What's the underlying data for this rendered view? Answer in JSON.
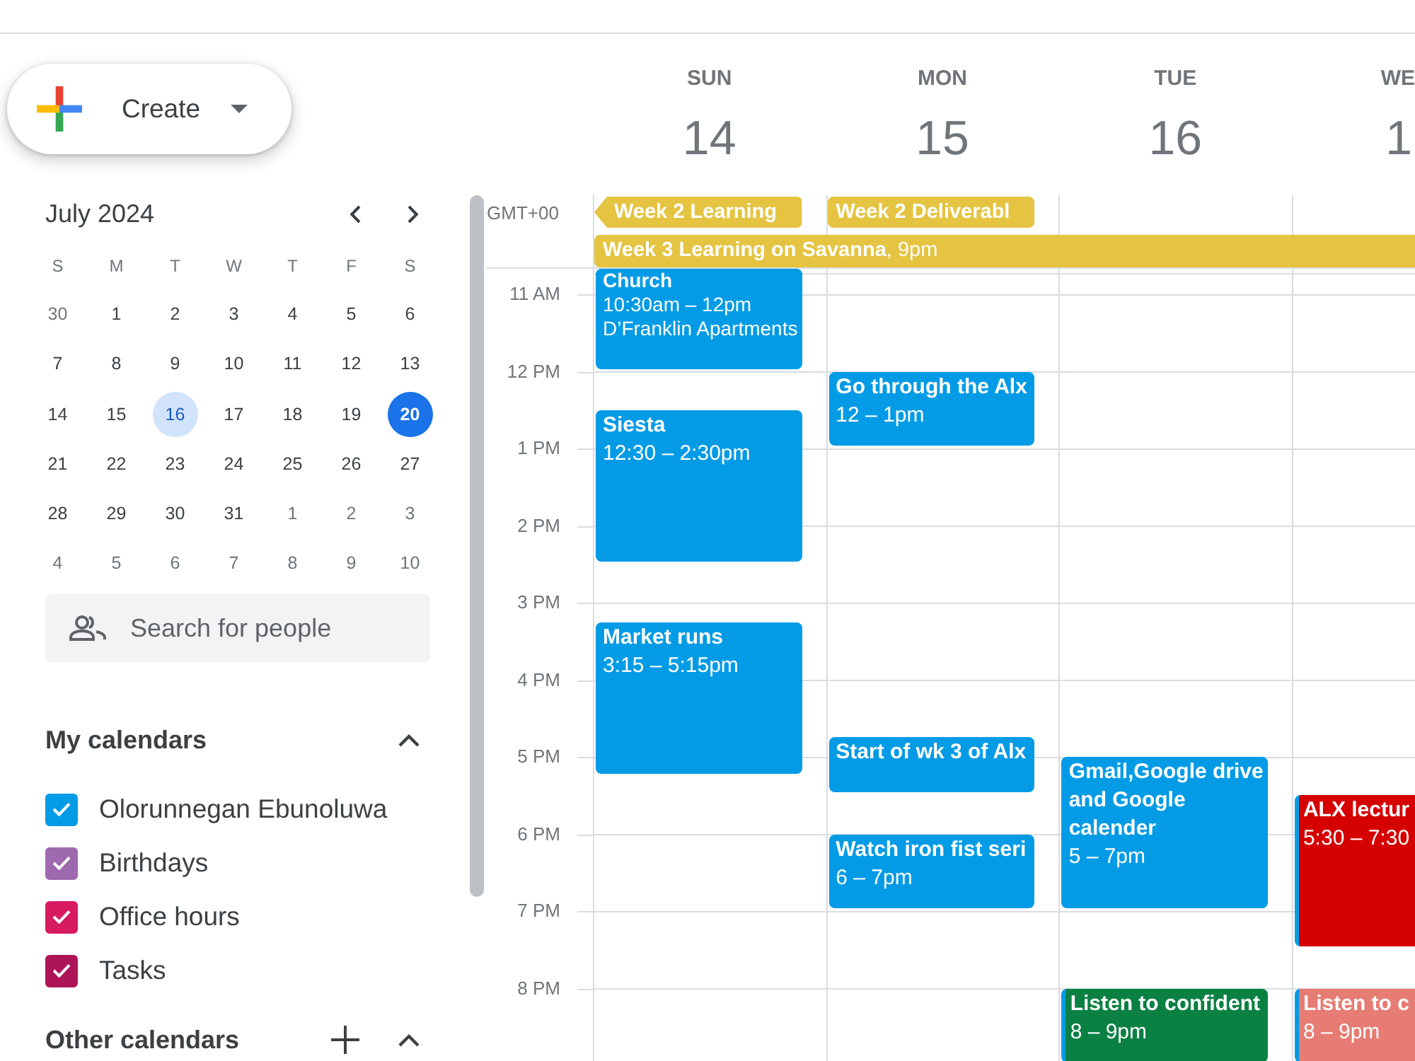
{
  "sidebar": {
    "create_button": {
      "label": "Create"
    },
    "mini_calendar": {
      "title": "July 2024",
      "weekdays": [
        "S",
        "M",
        "T",
        "W",
        "T",
        "F",
        "S"
      ],
      "weeks": [
        [
          {
            "label": "30",
            "outside": true,
            "selected": false,
            "today": false
          },
          {
            "label": "1",
            "outside": false,
            "selected": false,
            "today": false
          },
          {
            "label": "2",
            "outside": false,
            "selected": false,
            "today": false
          },
          {
            "label": "3",
            "outside": false,
            "selected": false,
            "today": false
          },
          {
            "label": "4",
            "outside": false,
            "selected": false,
            "today": false
          },
          {
            "label": "5",
            "outside": false,
            "selected": false,
            "today": false
          },
          {
            "label": "6",
            "outside": false,
            "selected": false,
            "today": false
          }
        ],
        [
          {
            "label": "7",
            "outside": false,
            "selected": false,
            "today": false
          },
          {
            "label": "8",
            "outside": false,
            "selected": false,
            "today": false
          },
          {
            "label": "9",
            "outside": false,
            "selected": false,
            "today": false
          },
          {
            "label": "10",
            "outside": false,
            "selected": false,
            "today": false
          },
          {
            "label": "11",
            "outside": false,
            "selected": false,
            "today": false
          },
          {
            "label": "12",
            "outside": false,
            "selected": false,
            "today": false
          },
          {
            "label": "13",
            "outside": false,
            "selected": false,
            "today": false
          }
        ],
        [
          {
            "label": "14",
            "outside": false,
            "selected": false,
            "today": false
          },
          {
            "label": "15",
            "outside": false,
            "selected": false,
            "today": false
          },
          {
            "label": "16",
            "outside": false,
            "selected": true,
            "today": false
          },
          {
            "label": "17",
            "outside": false,
            "selected": false,
            "today": false
          },
          {
            "label": "18",
            "outside": false,
            "selected": false,
            "today": false
          },
          {
            "label": "19",
            "outside": false,
            "selected": false,
            "today": false
          },
          {
            "label": "20",
            "outside": false,
            "selected": false,
            "today": true
          }
        ],
        [
          {
            "label": "21",
            "outside": false,
            "selected": false,
            "today": false
          },
          {
            "label": "22",
            "outside": false,
            "selected": false,
            "today": false
          },
          {
            "label": "23",
            "outside": false,
            "selected": false,
            "today": false
          },
          {
            "label": "24",
            "outside": false,
            "selected": false,
            "today": false
          },
          {
            "label": "25",
            "outside": false,
            "selected": false,
            "today": false
          },
          {
            "label": "26",
            "outside": false,
            "selected": false,
            "today": false
          },
          {
            "label": "27",
            "outside": false,
            "selected": false,
            "today": false
          }
        ],
        [
          {
            "label": "28",
            "outside": false,
            "selected": false,
            "today": false
          },
          {
            "label": "29",
            "outside": false,
            "selected": false,
            "today": false
          },
          {
            "label": "30",
            "outside": false,
            "selected": false,
            "today": false
          },
          {
            "label": "31",
            "outside": false,
            "selected": false,
            "today": false
          },
          {
            "label": "1",
            "outside": true,
            "selected": false,
            "today": false
          },
          {
            "label": "2",
            "outside": true,
            "selected": false,
            "today": false
          },
          {
            "label": "3",
            "outside": true,
            "selected": false,
            "today": false
          }
        ],
        [
          {
            "label": "4",
            "outside": true,
            "selected": false,
            "today": false
          },
          {
            "label": "5",
            "outside": true,
            "selected": false,
            "today": false
          },
          {
            "label": "6",
            "outside": true,
            "selected": false,
            "today": false
          },
          {
            "label": "7",
            "outside": true,
            "selected": false,
            "today": false
          },
          {
            "label": "8",
            "outside": true,
            "selected": false,
            "today": false
          },
          {
            "label": "9",
            "outside": true,
            "selected": false,
            "today": false
          },
          {
            "label": "10",
            "outside": true,
            "selected": false,
            "today": false
          }
        ]
      ]
    },
    "search": {
      "placeholder": "Search for people"
    },
    "my_calendars": {
      "title": "My calendars",
      "expanded": true,
      "items": [
        {
          "name": "Olorunnegan Ebunoluwa",
          "checked": true,
          "color": "#039be5"
        },
        {
          "name": "Birthdays",
          "checked": true,
          "color": "#9e69af"
        },
        {
          "name": "Office hours",
          "checked": true,
          "color": "#d81b60"
        },
        {
          "name": "Tasks",
          "checked": true,
          "color": "#ad1457"
        }
      ]
    },
    "other_calendars": {
      "title": "Other calendars",
      "expanded": true
    }
  },
  "week_view": {
    "timezone": "GMT+00",
    "hours": [
      "11 AM",
      "12 PM",
      "1 PM",
      "2 PM",
      "3 PM",
      "4 PM",
      "5 PM",
      "6 PM",
      "7 PM",
      "8 PM"
    ],
    "days": [
      {
        "weekday": "SUN",
        "date": "14",
        "all_day": [
          {
            "kind": "chip",
            "title": "Week 2 Learning",
            "continues_before": true,
            "color": "#e4c441"
          },
          {
            "kind": "bar",
            "title": "**Week 3 Learning on Savanna**, 9pm",
            "continues_before": false,
            "color": "#e4c441"
          }
        ],
        "events": [
          {
            "title": "Church",
            "time": "10:30am – 12pm",
            "location": "D’Franklin Apartments",
            "color": "#039be5",
            "overlapped": false
          },
          {
            "title": "Siesta",
            "time": "12:30 – 2:30pm",
            "color": "#039be5",
            "overlapped": false
          },
          {
            "title": "Market runs",
            "time": "3:15 – 5:15pm",
            "color": "#039be5",
            "overlapped": false
          }
        ]
      },
      {
        "weekday": "MON",
        "date": "15",
        "all_day": [
          {
            "kind": "chip",
            "title": "Week 2 Deliverabl",
            "continues_before": false,
            "color": "#e4c441"
          }
        ],
        "events": [
          {
            "title": "Go through the Alx",
            "time": "12 – 1pm",
            "color": "#039be5",
            "overlapped": false
          },
          {
            "title": "Start of wk 3 of Alx",
            "color": "#039be5",
            "overlapped": false
          },
          {
            "title": "Watch iron fist seri",
            "time": "6 – 7pm",
            "color": "#039be5",
            "overlapped": false
          }
        ]
      },
      {
        "weekday": "TUE",
        "date": "16",
        "events": [
          {
            "title": "Gmail,Google drive and Google calender",
            "time": "5 – 7pm",
            "color": "#039be5",
            "overlapped": false
          },
          {
            "title": "Listen to confident",
            "time": "8 – 9pm",
            "color": "#0b8043",
            "overlapped": true
          }
        ]
      },
      {
        "weekday": "WE",
        "date": "1",
        "events": [
          {
            "title": "ALX lectur",
            "time": "5:30 – 7:30",
            "color": "#d50000",
            "overlapped": true
          },
          {
            "title": "Listen to c",
            "time": "8 – 9pm",
            "color": "#e67c73",
            "overlapped": true
          }
        ]
      }
    ]
  }
}
